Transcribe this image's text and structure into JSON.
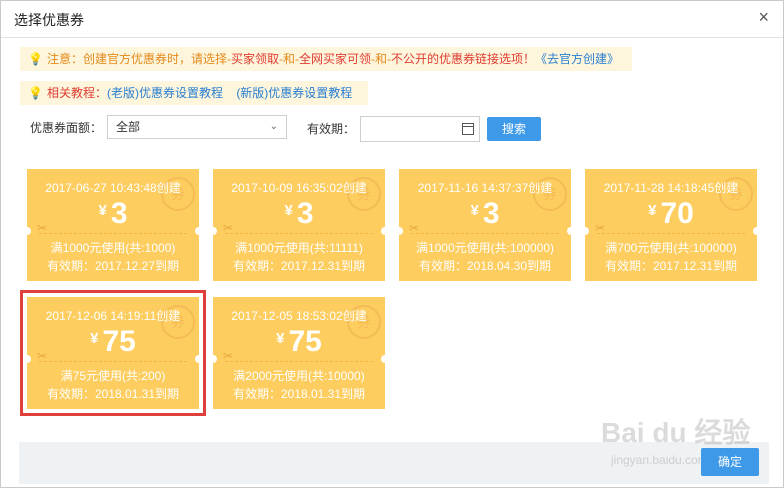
{
  "dialog": {
    "title": "选择优惠券",
    "close": "×",
    "ok_label": "确定"
  },
  "notices": {
    "line1_prefix": "注意：",
    "line1_text": "创建官方优惠券时，请选择-",
    "line1_highlight1": "买家领取",
    "line1_mid": "-和-",
    "line1_highlight2": "全网买家可领",
    "line1_mid2": "-和-",
    "line1_highlight3": "不公开的优惠券链接选项！",
    "line1_link": "《去官方创建》",
    "line2_prefix": "相关教程：",
    "line2_link1": "(老版)优惠券设置教程",
    "line2_link2": "(新版)优惠券设置教程"
  },
  "filters": {
    "denomination_label": "优惠券面额：",
    "denomination_value": "全部",
    "validity_label": "有效期：",
    "search_label": "搜索"
  },
  "coupons": [
    {
      "date": "2017-06-27 10:43:48创建",
      "currency": "¥",
      "amount": "3",
      "condition": "满1000元使用(共:1000)",
      "valid": "有效期：2017.12.27到期",
      "stamp": "券"
    },
    {
      "date": "2017-10-09 16:35:02创建",
      "currency": "¥",
      "amount": "3",
      "condition": "满1000元使用(共:11111)",
      "valid": "有效期：2017.12.31到期",
      "stamp": "券"
    },
    {
      "date": "2017-11-16 14:37:37创建",
      "currency": "¥",
      "amount": "3",
      "condition": "满1000元使用(共:100000)",
      "valid": "有效期：2018.04.30到期",
      "stamp": "券"
    },
    {
      "date": "2017-11-28 14:18:45创建",
      "currency": "¥",
      "amount": "70",
      "condition": "满700元使用(共:100000)",
      "valid": "有效期：2017.12.31到期",
      "stamp": "券"
    },
    {
      "date": "2017-12-06 14:19:11创建",
      "currency": "¥",
      "amount": "75",
      "condition": "满75元使用(共:200)",
      "valid": "有效期：2018.01.31到期",
      "stamp": "券"
    },
    {
      "date": "2017-12-05 18:53:02创建",
      "currency": "¥",
      "amount": "75",
      "condition": "满2000元使用(共:10000)",
      "valid": "有效期：2018.01.31到期",
      "stamp": "券"
    }
  ],
  "watermark": {
    "brand": "Bai du 经验",
    "url": "jingyan.baidu.com"
  },
  "colors": {
    "coupon": "#fecd5f",
    "accent": "#3e9ae8",
    "highlight": "#e0403a"
  }
}
